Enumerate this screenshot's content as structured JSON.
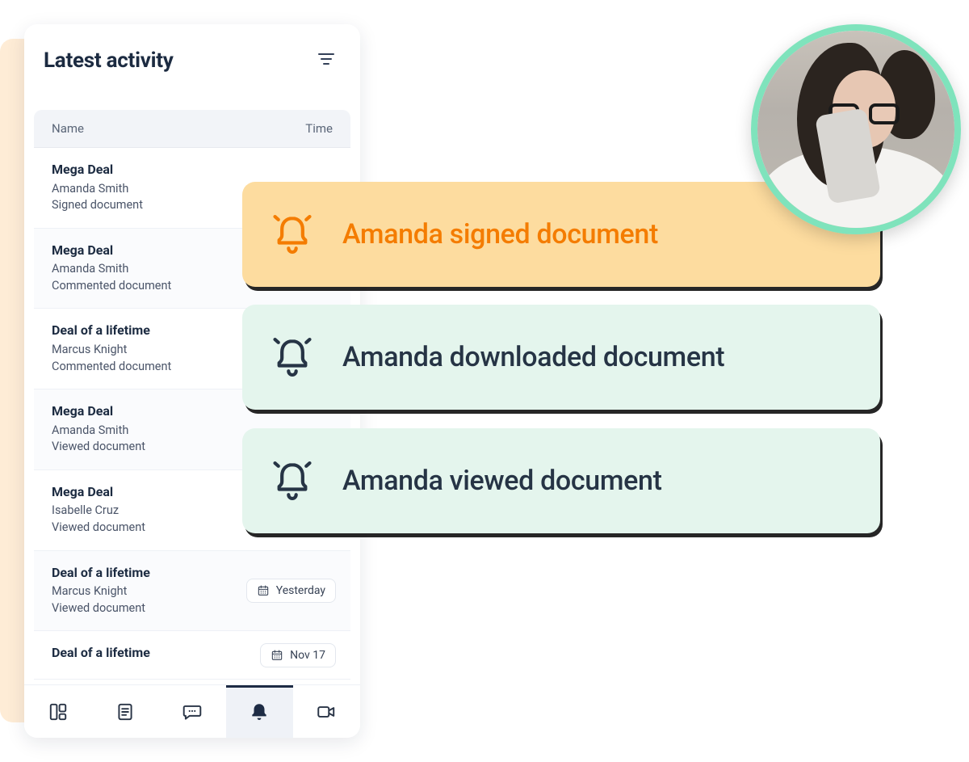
{
  "panel": {
    "title": "Latest activity",
    "columns": {
      "name": "Name",
      "time": "Time"
    },
    "rows": [
      {
        "title": "Mega Deal",
        "person": "Amanda Smith",
        "action": "Signed document"
      },
      {
        "title": "Mega Deal",
        "person": "Amanda Smith",
        "action": "Commented document"
      },
      {
        "title": "Deal of a lifetime",
        "person": "Marcus Knight",
        "action": "Commented document"
      },
      {
        "title": "Mega Deal",
        "person": "Amanda Smith",
        "action": "Viewed document"
      },
      {
        "title": "Mega Deal",
        "person": "Isabelle Cruz",
        "action": "Viewed document"
      },
      {
        "title": "Deal of a lifetime",
        "person": "Marcus Knight",
        "action": "Viewed document",
        "date": "Yesterday"
      },
      {
        "title": "Deal of a lifetime",
        "person": "",
        "action": "",
        "date": "Nov 17"
      }
    ]
  },
  "tabs": {
    "items": [
      "dashboard",
      "document",
      "chat",
      "notifications",
      "video"
    ],
    "active": "notifications"
  },
  "toasts": [
    {
      "message": "Amanda signed document"
    },
    {
      "message": "Amanda downloaded document"
    },
    {
      "message": "Amanda viewed document"
    }
  ],
  "avatar": {
    "alt": "User looking at phone"
  }
}
